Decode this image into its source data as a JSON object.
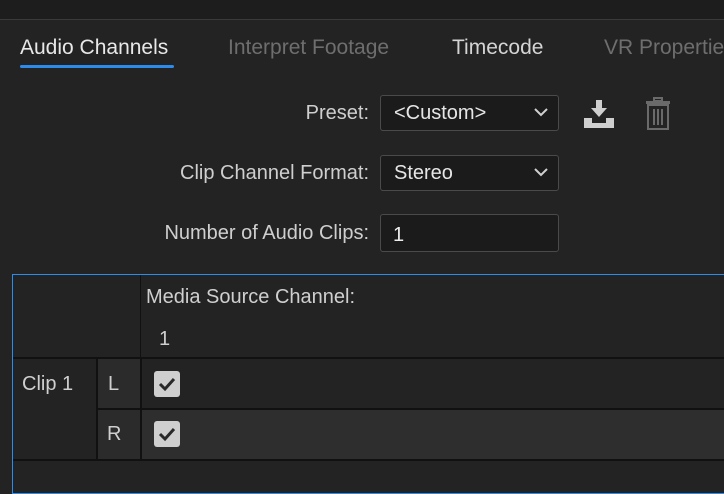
{
  "tabs": [
    {
      "label": "Audio Channels",
      "state": "active"
    },
    {
      "label": "Interpret Footage",
      "state": "disabled"
    },
    {
      "label": "Timecode",
      "state": "normal"
    },
    {
      "label": "VR Properties",
      "state": "disabled"
    }
  ],
  "form": {
    "preset_label": "Preset:",
    "preset_value": "<Custom>",
    "clip_channel_format_label": "Clip Channel Format:",
    "clip_channel_format_value": "Stereo",
    "num_audio_clips_label": "Number of Audio Clips:",
    "num_audio_clips_value": "1"
  },
  "icons": {
    "save_preset": "download-icon",
    "delete_preset": "trash-icon",
    "dropdown": "chevron-down-icon"
  },
  "grid": {
    "header_title": "Media Source Channel:",
    "columns": [
      "1"
    ],
    "clips": [
      {
        "label": "Clip 1",
        "channels": [
          {
            "label": "L",
            "checked": [
              true
            ]
          },
          {
            "label": "R",
            "checked": [
              true
            ]
          }
        ]
      }
    ]
  },
  "colors": {
    "accent": "#2d8ceb",
    "background": "#232323"
  }
}
